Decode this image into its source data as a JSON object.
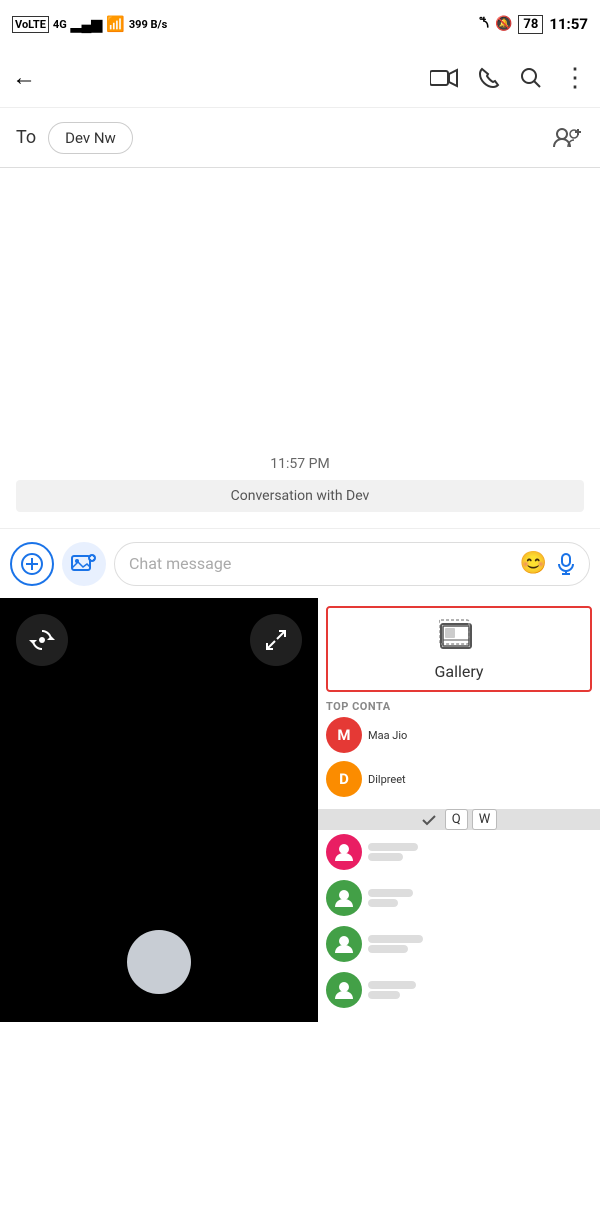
{
  "statusBar": {
    "left": "VoLTE 4G",
    "signal": "▂▄▆",
    "wifi": "WiFi",
    "speed": "399 B/s",
    "bluetooth": "BT",
    "mute": "🔕",
    "battery": "78",
    "time": "11:57"
  },
  "topBar": {
    "backLabel": "←",
    "videoIcon": "video-camera-icon",
    "phoneIcon": "phone-icon",
    "searchIcon": "search-icon",
    "moreIcon": "more-vert-icon"
  },
  "toRow": {
    "label": "To",
    "contactName": "Dev Nw",
    "addPeopleIcon": "add-people-icon"
  },
  "messageArea": {
    "timestamp": "11:57 PM",
    "conversationLabel": "Conversation with Dev"
  },
  "inputRow": {
    "addIcon": "add-circle-icon",
    "galleryInputIcon": "gallery-input-icon",
    "placeholder": "Chat message",
    "emojiIcon": "emoji-icon",
    "micIcon": "mic-icon"
  },
  "cameraPanel": {
    "rotateIcon": "rotate-camera-icon",
    "expandIcon": "expand-icon",
    "shutterLabel": ""
  },
  "galleryTile": {
    "label": "Gallery",
    "icon": "gallery-icon"
  },
  "topContacts": {
    "header": "TOP CONTA",
    "contacts": [
      {
        "initial": "M",
        "name": "Maa Jio",
        "color": "#e53935"
      },
      {
        "initial": "D",
        "name": "Dilpreet",
        "color": "#fb8c00"
      }
    ]
  },
  "keyboardHint": {
    "key1": "Q",
    "key2": "W"
  },
  "moreContacts": [
    {
      "color": "#e91e63"
    },
    {
      "color": "#43a047"
    },
    {
      "color": "#43a047"
    },
    {
      "color": "#43a047"
    }
  ]
}
